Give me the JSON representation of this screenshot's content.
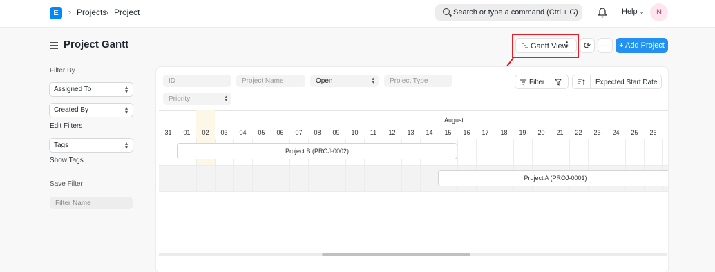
{
  "navbar": {
    "logo_letter": "E",
    "breadcrumbs": [
      "Projects",
      "Project"
    ],
    "search_placeholder": "Search or type a command (Ctrl + G)",
    "help_label": "Help",
    "avatar_initial": "N"
  },
  "header": {
    "title": "Project Gantt",
    "view_label": "Gantt View",
    "add_label": "+ Add Project",
    "more_label": "···"
  },
  "sidebar": {
    "filter_by": "Filter By",
    "assigned_to": "Assigned To",
    "created_by": "Created By",
    "edit_filters": "Edit Filters",
    "tags": "Tags",
    "show_tags": "Show Tags",
    "save_filter": "Save Filter",
    "filter_name_placeholder": "Filter Name"
  },
  "filters": {
    "id_placeholder": "ID",
    "project_name_placeholder": "Project Name",
    "status_value": "Open",
    "project_type_placeholder": "Project Type",
    "priority_placeholder": "Priority",
    "filter_label": "Filter",
    "sort_label": "Expected Start Date"
  },
  "gantt": {
    "month": "August",
    "days": [
      "31",
      "01",
      "02",
      "03",
      "04",
      "05",
      "06",
      "07",
      "08",
      "09",
      "10",
      "11",
      "12",
      "13",
      "14",
      "15",
      "16",
      "17",
      "18",
      "19",
      "20",
      "21",
      "22",
      "23",
      "24",
      "25",
      "26"
    ],
    "tasks": [
      {
        "name": "Project B (PROJ-0002)"
      },
      {
        "name": "Project A (PROJ-0001)"
      }
    ]
  },
  "colors": {
    "primary": "#2490ef",
    "highlight": "#ec1c24",
    "today": "#fdf7e8"
  }
}
